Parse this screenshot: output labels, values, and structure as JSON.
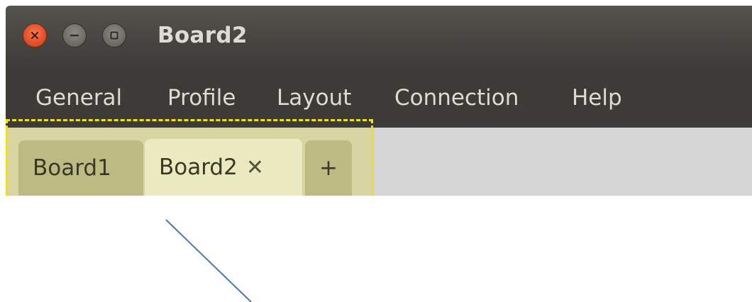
{
  "window": {
    "title": "Board2",
    "controls": {
      "close_icon": "close-icon",
      "minimize_icon": "minimize-icon",
      "maximize_icon": "maximize-icon"
    }
  },
  "menu": {
    "items": [
      {
        "label": "General"
      },
      {
        "label": "Profile"
      },
      {
        "label": "Layout"
      },
      {
        "label": "Connection"
      },
      {
        "label": "Help"
      }
    ]
  },
  "tabs": {
    "items": [
      {
        "label": "Board1",
        "active": false
      },
      {
        "label": "Board2",
        "active": true,
        "close_glyph": "✕"
      }
    ],
    "add_label": "+"
  },
  "colors": {
    "titlebar": "#3c3b37",
    "tab_pane": "#d8d5a3",
    "tab_inactive": "#bdba83",
    "tab_active": "#ebe9bf",
    "highlight": "#f2e20a",
    "close_button": "#e4522a",
    "connector_line": "#4a78b4"
  }
}
